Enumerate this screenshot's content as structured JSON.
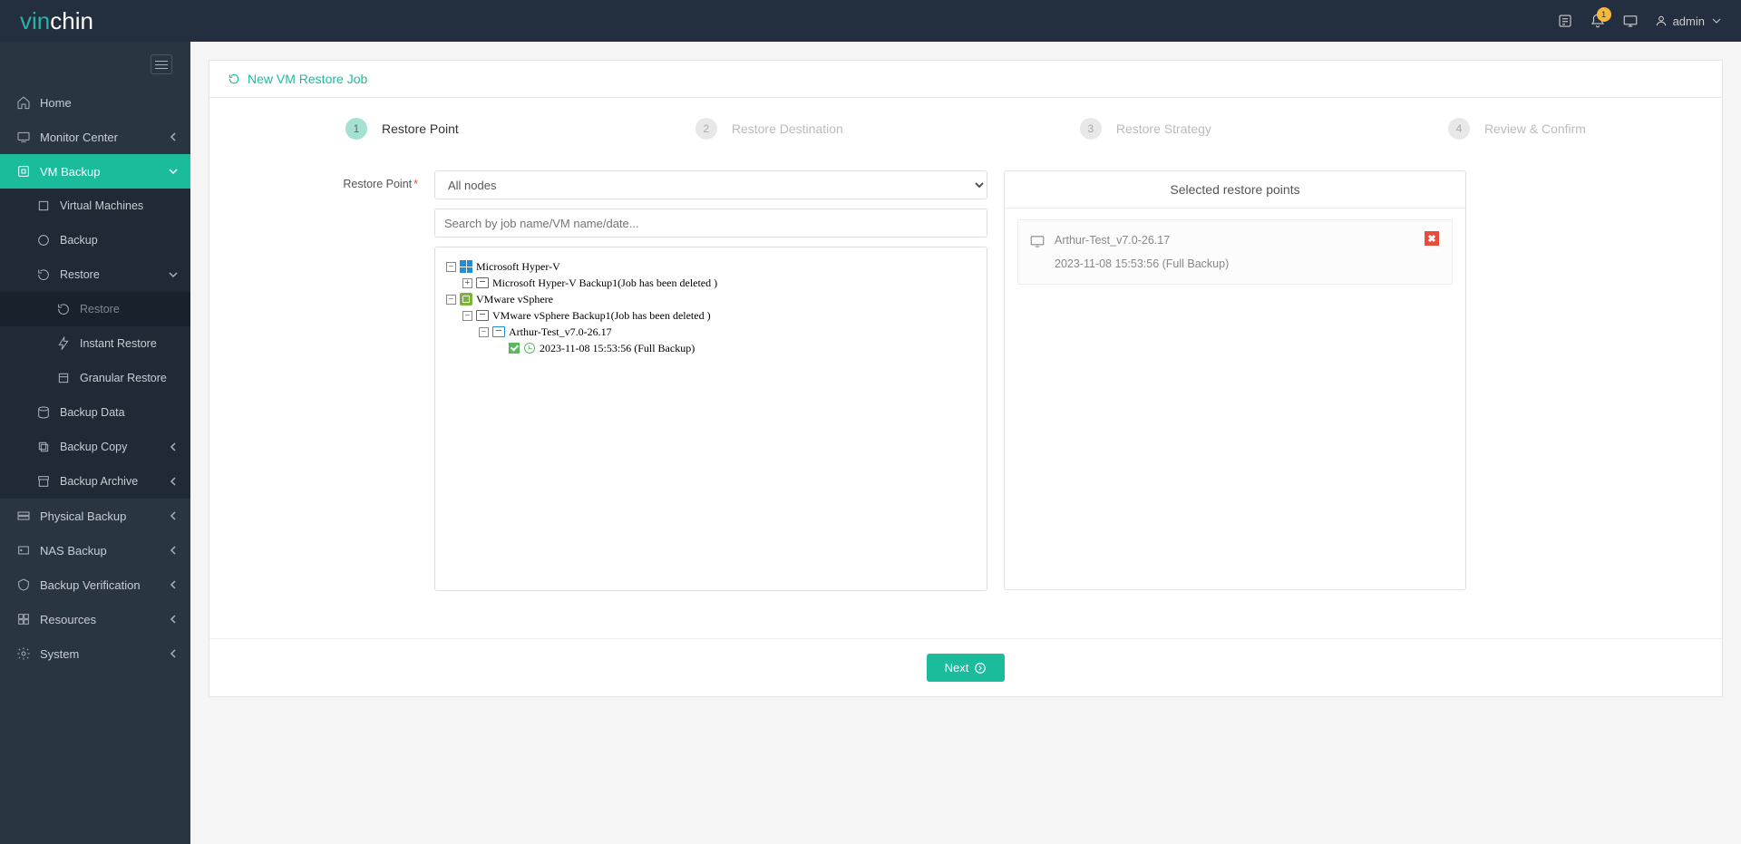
{
  "header": {
    "logo_part1": "vin",
    "logo_part2": "chin",
    "user": "admin",
    "bell_count": "1"
  },
  "sidebar": {
    "home": "Home",
    "monitor": "Monitor Center",
    "vmbackup": "VM Backup",
    "vmbackup_children": {
      "virtual_machines": "Virtual Machines",
      "backup": "Backup",
      "restore": "Restore",
      "restore_children": {
        "restore": "Restore",
        "instant_restore": "Instant Restore",
        "granular_restore": "Granular Restore"
      },
      "backup_data": "Backup Data",
      "backup_copy": "Backup Copy",
      "backup_archive": "Backup Archive"
    },
    "physical_backup": "Physical Backup",
    "nas_backup": "NAS Backup",
    "backup_verification": "Backup Verification",
    "resources": "Resources",
    "system": "System"
  },
  "page": {
    "title": "New VM Restore Job",
    "steps": [
      {
        "num": "1",
        "label": "Restore Point"
      },
      {
        "num": "2",
        "label": "Restore Destination"
      },
      {
        "num": "3",
        "label": "Restore Strategy"
      },
      {
        "num": "4",
        "label": "Review & Confirm"
      }
    ],
    "field_label": "Restore Point",
    "node_selected": "All nodes",
    "search_placeholder": "Search by job name/VM name/date...",
    "next": "Next"
  },
  "tree": {
    "hyperv": "Microsoft Hyper-V",
    "hyperv_job": "Microsoft Hyper-V Backup1(Job has been deleted )",
    "vsphere": "VMware vSphere",
    "vsphere_job": "VMware vSphere Backup1(Job has been deleted )",
    "vm_name": "Arthur-Test_v7.0-26.17",
    "restore_point": "2023-11-08 15:53:56 (Full  Backup)"
  },
  "selected_panel": {
    "title": "Selected restore points",
    "vm": "Arthur-Test_v7.0-26.17",
    "detail": "2023-11-08 15:53:56 (Full Backup)"
  }
}
